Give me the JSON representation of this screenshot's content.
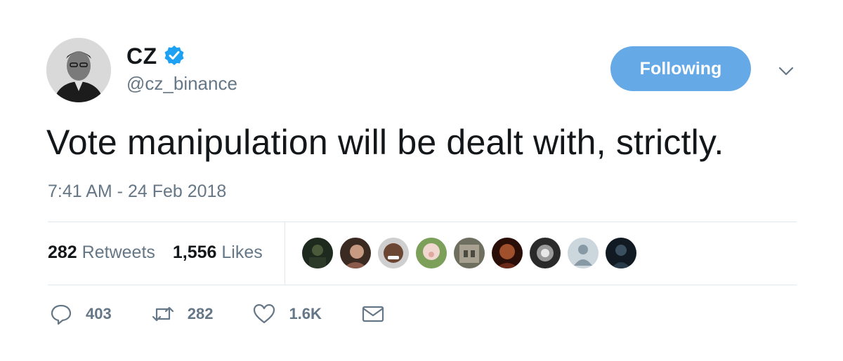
{
  "user": {
    "display_name": "CZ",
    "handle": "@cz_binance",
    "verified": true
  },
  "follow_button": {
    "label": "Following"
  },
  "tweet": {
    "text": "Vote manipulation will be dealt with, strictly.",
    "timestamp": "7:41 AM - 24 Feb 2018"
  },
  "stats": {
    "retweets": {
      "count": "282",
      "label": "Retweets"
    },
    "likes": {
      "count": "1,556",
      "label": "Likes"
    }
  },
  "likers": [
    {
      "icon": "liker-avatar-1",
      "color": "#2d3a2a"
    },
    {
      "icon": "liker-avatar-2",
      "color": "#8a5a4a"
    },
    {
      "icon": "liker-avatar-3",
      "color": "#5b3b2a"
    },
    {
      "icon": "liker-avatar-4",
      "color": "#b9c48a"
    },
    {
      "icon": "liker-avatar-5",
      "color": "#8a8a7a"
    },
    {
      "icon": "liker-avatar-6",
      "color": "#6a2a1a"
    },
    {
      "icon": "liker-avatar-7",
      "color": "#3a3a3a"
    },
    {
      "icon": "liker-avatar-8",
      "color": "#ccd6dd"
    },
    {
      "icon": "liker-avatar-9",
      "color": "#1f2a33"
    }
  ],
  "actions": {
    "reply": {
      "icon": "reply-icon",
      "count": "403"
    },
    "retweet": {
      "icon": "retweet-icon",
      "count": "282"
    },
    "like": {
      "icon": "heart-icon",
      "count": "1.6K"
    },
    "dm": {
      "icon": "envelope-icon"
    }
  },
  "colors": {
    "accent": "#1da1f2",
    "follow_button_bg": "#66a9e7",
    "muted_text": "#657786",
    "divider": "#e1e8ed"
  }
}
